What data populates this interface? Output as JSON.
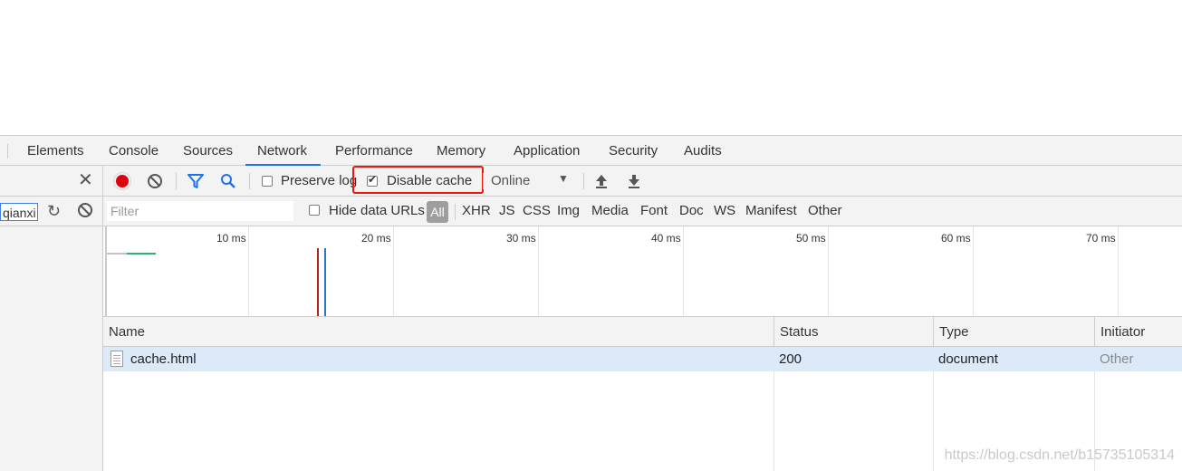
{
  "tabs": [
    "Elements",
    "Console",
    "Sources",
    "Network",
    "Performance",
    "Memory",
    "Application",
    "Security",
    "Audits"
  ],
  "active_tab": "Network",
  "sidebar": {
    "search_value": "qianxi"
  },
  "toolbar": {
    "preserve_log_label": "Preserve log",
    "preserve_log_checked": false,
    "disable_cache_label": "Disable cache",
    "disable_cache_checked": true,
    "throttle_value": "Online"
  },
  "filter_bar": {
    "filter_placeholder": "Filter",
    "hide_data_urls_label": "Hide data URLs",
    "type_filters": [
      "All",
      "XHR",
      "JS",
      "CSS",
      "Img",
      "Media",
      "Font",
      "Doc",
      "WS",
      "Manifest",
      "Other"
    ],
    "active_type": "All"
  },
  "timeline": {
    "ticks": [
      "10 ms",
      "20 ms",
      "30 ms",
      "40 ms",
      "50 ms",
      "60 ms",
      "70 ms"
    ]
  },
  "table": {
    "columns": [
      "Name",
      "Status",
      "Type",
      "Initiator"
    ],
    "rows": [
      {
        "name": "cache.html",
        "status": "200",
        "type": "document",
        "initiator": "Other"
      }
    ]
  },
  "watermark": "https://blog.csdn.net/b15735105314",
  "colors": {
    "accent": "#1a73e8",
    "record": "#e0000b",
    "highlight": "#e8180d",
    "selected_row": "#dbe9f8"
  }
}
